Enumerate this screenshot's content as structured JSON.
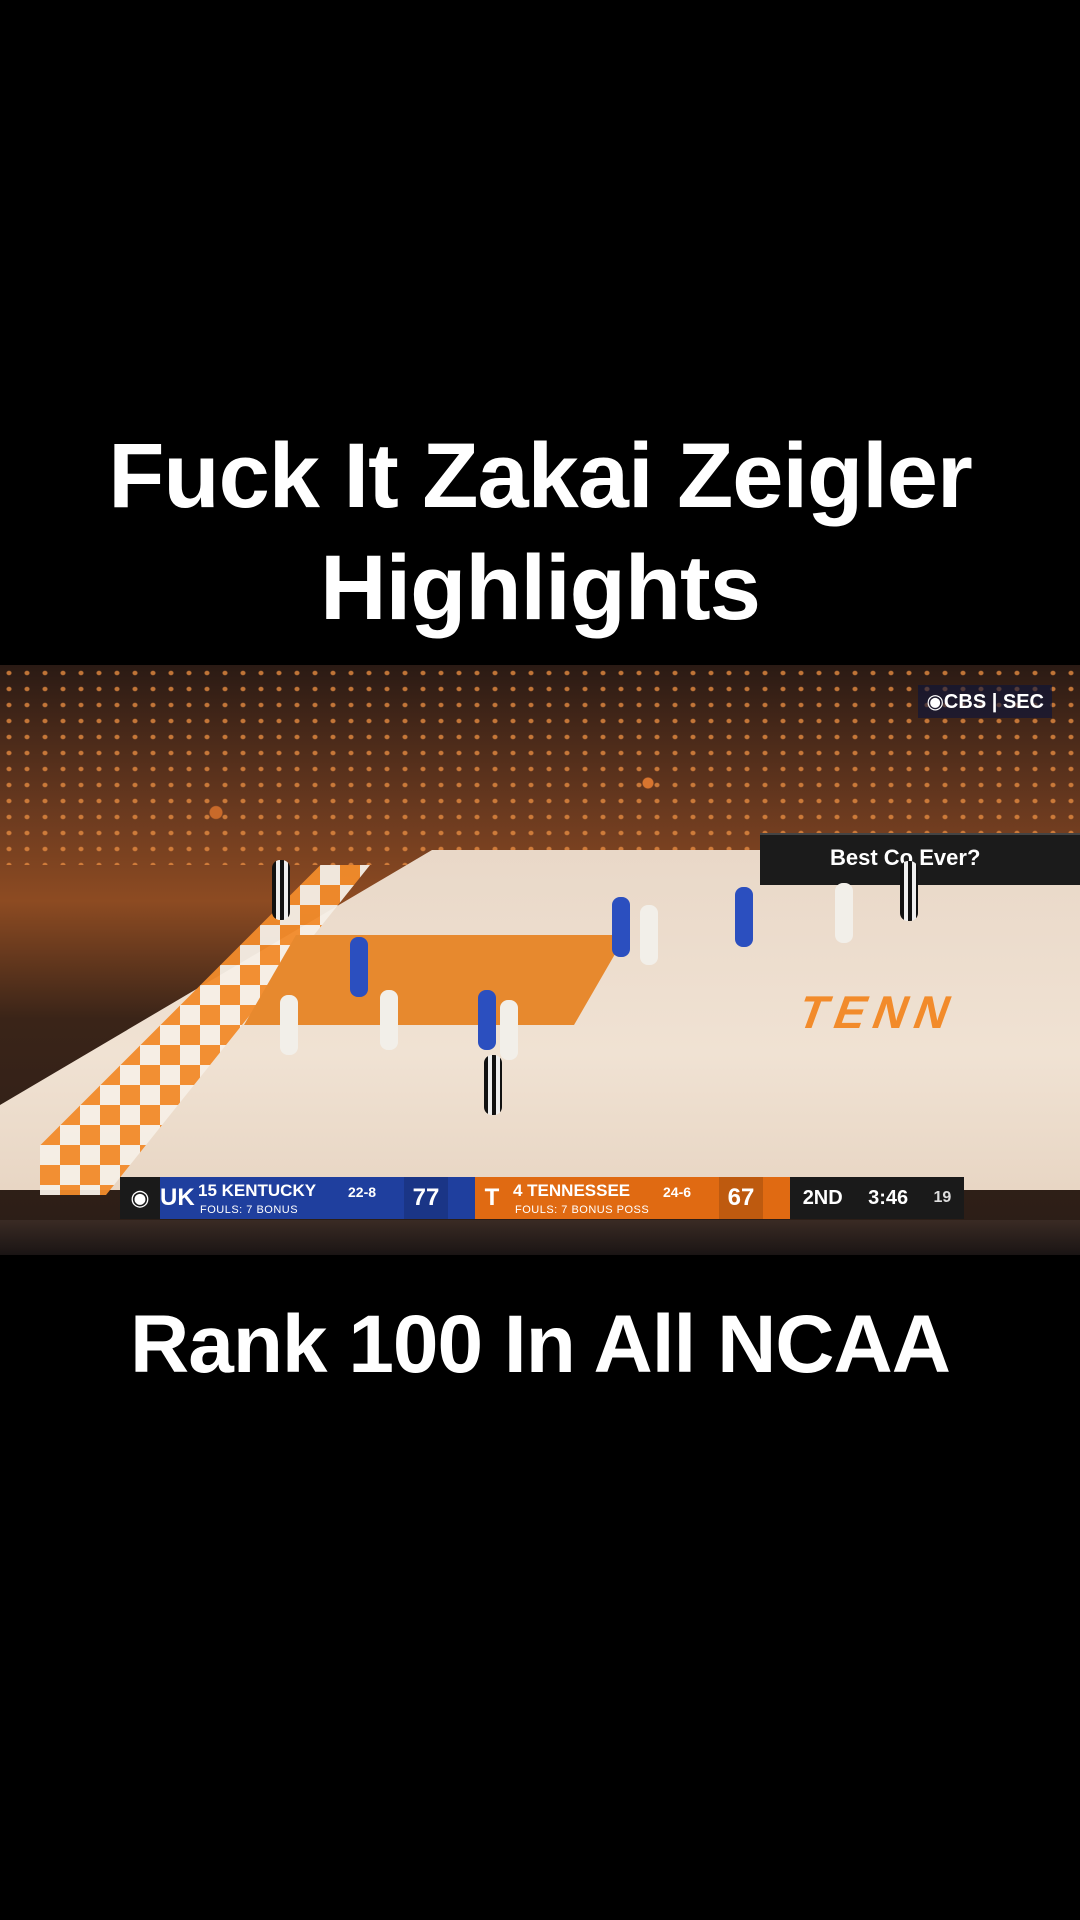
{
  "captions": {
    "top_line1": "Fuck It Zakai Zeigler",
    "top_line2": "Highlights",
    "bottom": "Rank 100 In All NCAA"
  },
  "broadcast": {
    "network": "◉CBS | SEC",
    "ad_text": "Best Co   Ever?",
    "court_word": "TENN"
  },
  "scorebug": {
    "network_icon": "cbs-eye-icon",
    "away": {
      "mark": "UK",
      "name": "15 KENTUCKY",
      "record": "22-8",
      "score": "77",
      "sub": "FOULS: 7   BONUS",
      "color": "#1f3f9e"
    },
    "home": {
      "mark": "T",
      "name": "4 TENNESSEE",
      "record": "24-6",
      "score": "67",
      "sub": "FOULS: 7   BONUS   POSS",
      "color": "#e06a12"
    },
    "period": "2ND",
    "clock": "3:46",
    "shot_clock": "19"
  }
}
